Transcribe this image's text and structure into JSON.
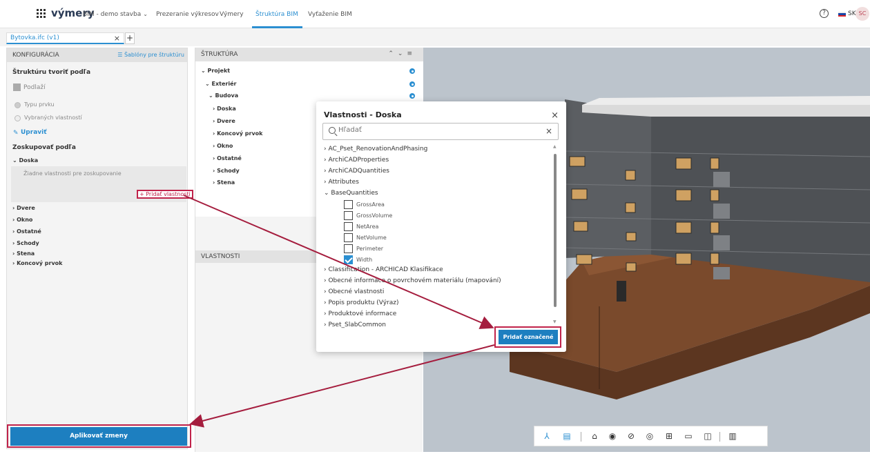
{
  "app": {
    "brand": "výmery",
    "nav": [
      {
        "label": "BIM - demo stavba",
        "dropdown": true
      },
      {
        "label": "Prezeranie výkresov"
      },
      {
        "label": "Výmery"
      },
      {
        "label": "Štruktúra BIM",
        "active": true
      },
      {
        "label": "Vyťaženie BIM"
      }
    ],
    "help_icon": "question-circle-icon",
    "lang": "SK",
    "avatar_initials": "SC"
  },
  "file_tab": {
    "label": "Bytovka.ifc (v1)",
    "close": "×",
    "add": "+"
  },
  "config_panel": {
    "title": "KONFIGURÁCIA",
    "templates_link": "Šablóny pre štruktúru",
    "build_by_label": "Štruktúru tvoriť podľa",
    "floors_option": "Podlaží",
    "type_option": "Typu prvku",
    "selected_props_option": "Vybraných vlastností",
    "edit_label": "Upraviť",
    "group_by_label": "Zoskupovať podľa",
    "groups": [
      "Doska",
      "Dvere",
      "Okno",
      "Ostatné",
      "Schody",
      "Stena",
      "Koncový prvok"
    ],
    "group_expanded": "Doska",
    "no_props_text": "Žiadne vlastnosti pre zoskupovanie",
    "add_property": "+ Pridať vlastnosti",
    "apply_button": "Aplikovať zmeny"
  },
  "structure_panel": {
    "title": "ŠTRUKTÚRA",
    "items": [
      {
        "label": "Projekt",
        "expanded": true
      },
      {
        "label": "Exteriér",
        "expanded": true
      },
      {
        "label": "Budova",
        "expanded": true
      },
      {
        "label": "Doska"
      },
      {
        "label": "Dvere"
      },
      {
        "label": "Koncový prvok"
      },
      {
        "label": "Okno"
      },
      {
        "label": "Ostatné"
      },
      {
        "label": "Schody"
      },
      {
        "label": "Stena"
      }
    ],
    "properties_title": "VLASTNOSTI"
  },
  "modal": {
    "title": "Vlastnosti - Doska",
    "close": "×",
    "search_placeholder": "Hľadať",
    "groups": [
      "AC_Pset_RenovationAndPhasing",
      "ArchiCADProperties",
      "ArchiCADQuantities",
      "Attributes",
      "BaseQuantities",
      "Classification - ARCHICAD Klasifikace",
      "Obecné informace o povrchovém materiálu (mapování)",
      "Obecné vlastnosti",
      "Popis produktu (Výraz)",
      "Produktové informace",
      "Pset_SlabCommon"
    ],
    "expanded_group": "BaseQuantities",
    "base_quantities": [
      {
        "label": "GrossArea",
        "checked": false
      },
      {
        "label": "GrossVolume",
        "checked": false
      },
      {
        "label": "NetArea",
        "checked": false
      },
      {
        "label": "NetVolume",
        "checked": false
      },
      {
        "label": "Perimeter",
        "checked": false
      },
      {
        "label": "Width",
        "checked": true
      }
    ],
    "add_selected": "Pridať označené"
  },
  "toolbar_icons": [
    "structure-icon",
    "list-icon",
    "home-icon",
    "eye-icon",
    "eye-off-icon",
    "target-icon",
    "section-icon",
    "ruler-icon",
    "split-view-icon",
    "layers-icon"
  ],
  "colors": {
    "accent": "#2b8fd1",
    "primary_button": "#1d7fc0",
    "highlight": "#c0224a"
  }
}
